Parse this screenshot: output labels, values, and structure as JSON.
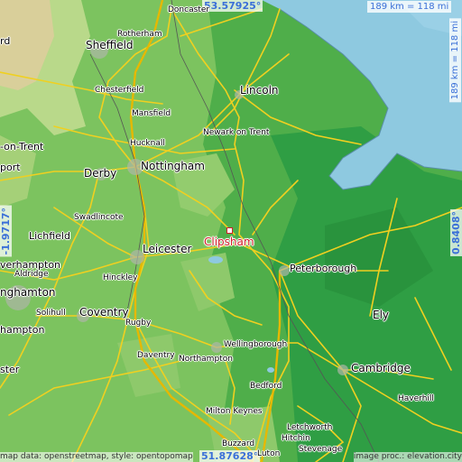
{
  "map": {
    "focus_place": "Clipsham",
    "colors": {
      "sea": "#8ec9e0",
      "lowland": "#2f9e44",
      "midland": "#6fc35b",
      "upland": "#b5d98a",
      "highland": "#d9cf9a",
      "road": "#f0d020",
      "focus": "#d0202a",
      "coord": "#3a6fd8"
    },
    "coords": {
      "top": "53.57925°",
      "bottom": "51.87628°",
      "left": "-1.9717°",
      "right": "0.8408°"
    },
    "scale": {
      "horizontal": "189 km = 118 mi",
      "vertical": "189 km = 118 mi"
    },
    "credits": {
      "left": "map data: openstreetmap, style: opentopomap",
      "right": "image proc.: elevation.city"
    },
    "places": [
      {
        "key": "doncaster",
        "name": "Doncaster"
      },
      {
        "key": "rotherham",
        "name": "Rotherham"
      },
      {
        "key": "sheffield",
        "name": "Sheffield"
      },
      {
        "key": "chesterfield",
        "name": "Chesterfield"
      },
      {
        "key": "lincoln",
        "name": "Lincoln"
      },
      {
        "key": "mansfield",
        "name": "Mansfield"
      },
      {
        "key": "newark",
        "name": "Newark on Trent"
      },
      {
        "key": "on_trent",
        "name": "-on-Trent"
      },
      {
        "key": "hucknall",
        "name": "Hucknall"
      },
      {
        "key": "derby",
        "name": "Derby"
      },
      {
        "key": "nottingham",
        "name": "Nottingham"
      },
      {
        "key": "swadlincote",
        "name": "Swadlincote"
      },
      {
        "key": "lichfield",
        "name": "Lichfield"
      },
      {
        "key": "leicester",
        "name": "Leicester"
      },
      {
        "key": "peterborough",
        "name": "Peterborough"
      },
      {
        "key": "verhampton",
        "name": "verhampton"
      },
      {
        "key": "aldridge",
        "name": "Aldridge"
      },
      {
        "key": "nghamton",
        "name": "nghamton"
      },
      {
        "key": "hinckley",
        "name": "Hinckley"
      },
      {
        "key": "ely",
        "name": "Ely"
      },
      {
        "key": "solihull",
        "name": "Solihull"
      },
      {
        "key": "coventry",
        "name": "Coventry"
      },
      {
        "key": "rugby",
        "name": "Rugby"
      },
      {
        "key": "hampton",
        "name": "hampton"
      },
      {
        "key": "wellingborough",
        "name": "Wellingborough"
      },
      {
        "key": "daventry",
        "name": "Daventry"
      },
      {
        "key": "northampton",
        "name": "Northampton"
      },
      {
        "key": "cambridge",
        "name": "Cambridge"
      },
      {
        "key": "ster",
        "name": "ster"
      },
      {
        "key": "bedford",
        "name": "Bedford"
      },
      {
        "key": "haverhill",
        "name": "Haverhill"
      },
      {
        "key": "milton_keynes",
        "name": "Milton Keynes"
      },
      {
        "key": "letchworth",
        "name": "Letchworth"
      },
      {
        "key": "hitchin",
        "name": "Hitchin"
      },
      {
        "key": "buzzard",
        "name": "Buzzard"
      },
      {
        "key": "luton",
        "name": "Luton"
      },
      {
        "key": "stevenage",
        "name": "Stevenage"
      },
      {
        "key": "port",
        "name": "port"
      },
      {
        "key": "rd",
        "name": "rd"
      }
    ]
  }
}
